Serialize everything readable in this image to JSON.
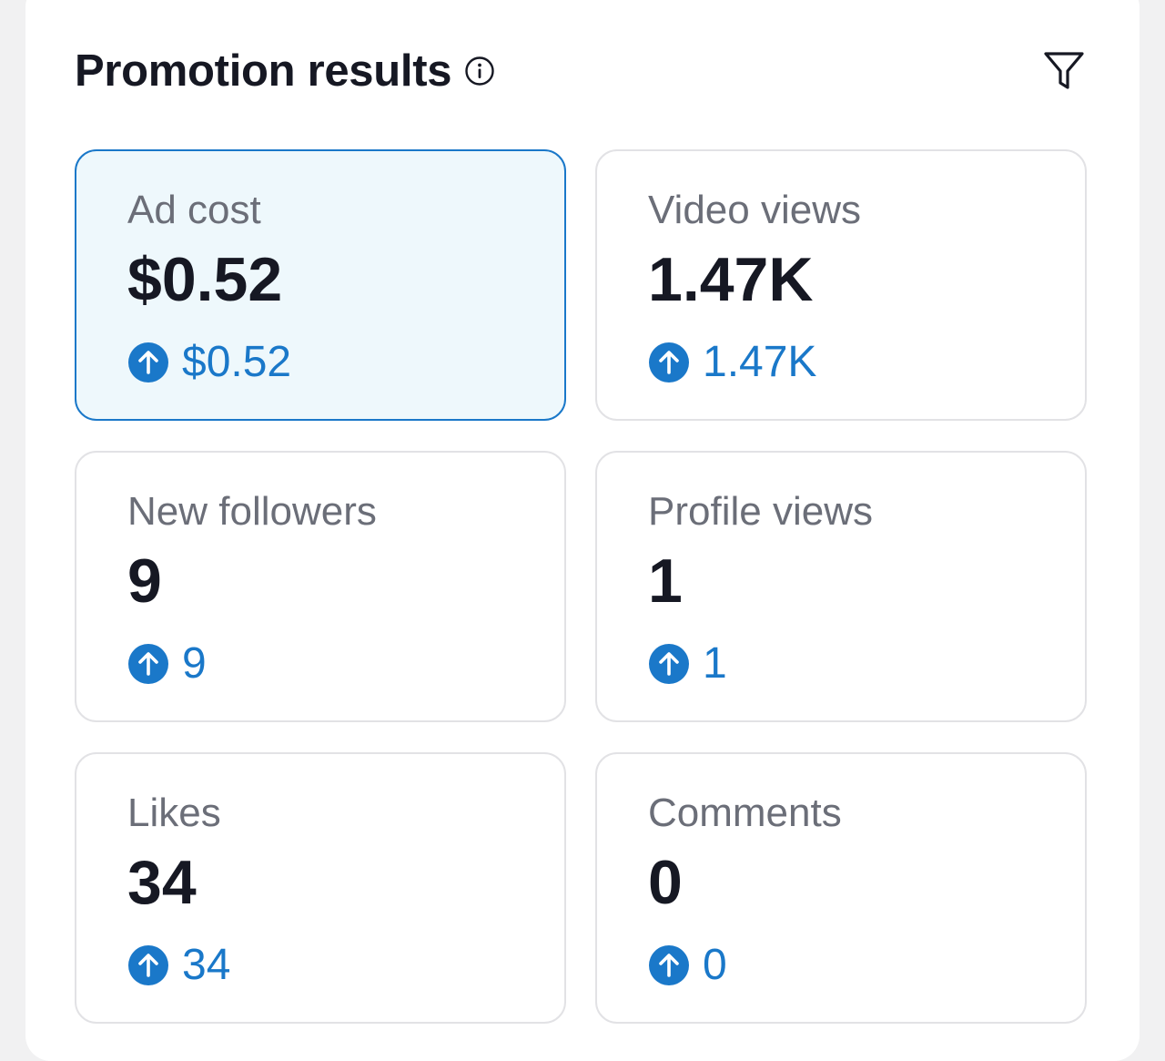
{
  "header": {
    "title": "Promotion results"
  },
  "icons": {
    "info": "info-icon",
    "filter": "filter-icon",
    "delta": "arrow-up-circle-icon"
  },
  "colors": {
    "accent": "#1a78c9",
    "selected_bg": "#eef8fc",
    "text_primary": "#161823",
    "text_secondary": "#6b6e78",
    "card_border": "#e2e2e5"
  },
  "metrics": [
    {
      "label": "Ad cost",
      "value": "$0.52",
      "delta": "$0.52",
      "selected": true
    },
    {
      "label": "Video views",
      "value": "1.47K",
      "delta": "1.47K",
      "selected": false
    },
    {
      "label": "New followers",
      "value": "9",
      "delta": "9",
      "selected": false
    },
    {
      "label": "Profile views",
      "value": "1",
      "delta": "1",
      "selected": false
    },
    {
      "label": "Likes",
      "value": "34",
      "delta": "34",
      "selected": false
    },
    {
      "label": "Comments",
      "value": "0",
      "delta": "0",
      "selected": false
    }
  ]
}
